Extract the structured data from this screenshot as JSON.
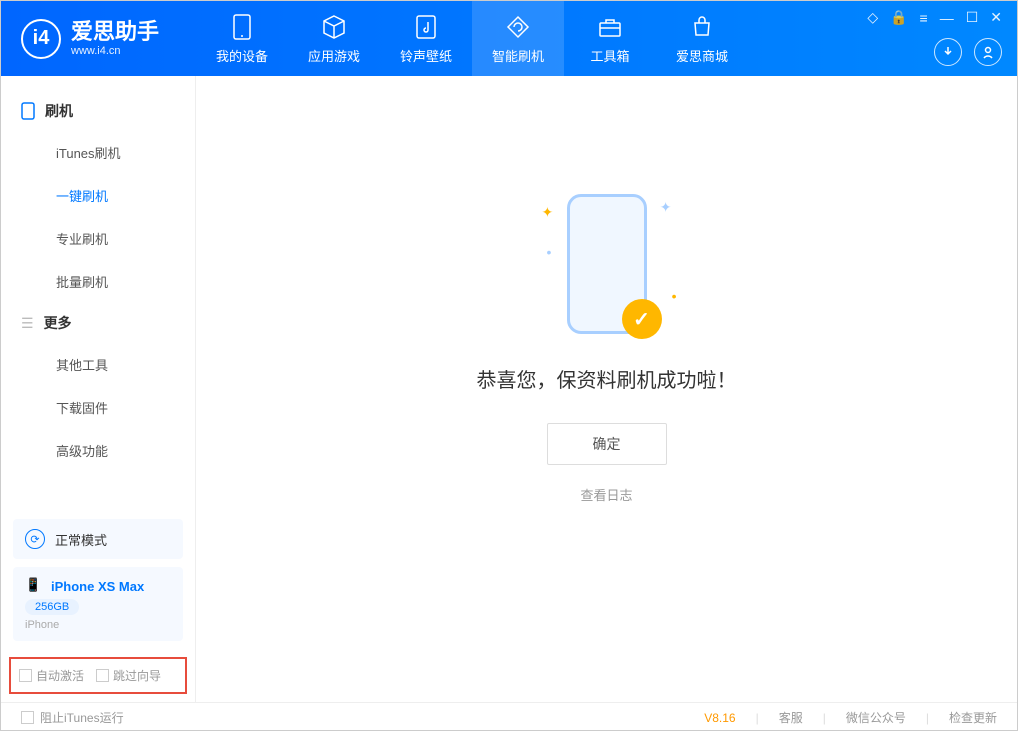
{
  "app": {
    "name": "爱思助手",
    "url": "www.i4.cn"
  },
  "nav": {
    "tabs": [
      {
        "label": "我的设备",
        "icon": "device"
      },
      {
        "label": "应用游戏",
        "icon": "cube"
      },
      {
        "label": "铃声壁纸",
        "icon": "music"
      },
      {
        "label": "智能刷机",
        "icon": "refresh"
      },
      {
        "label": "工具箱",
        "icon": "toolbox"
      },
      {
        "label": "爱思商城",
        "icon": "shop"
      }
    ]
  },
  "sidebar": {
    "section1_title": "刷机",
    "section1_items": [
      "iTunes刷机",
      "一键刷机",
      "专业刷机",
      "批量刷机"
    ],
    "section2_title": "更多",
    "section2_items": [
      "其他工具",
      "下载固件",
      "高级功能"
    ],
    "mode_label": "正常模式",
    "device": {
      "name": "iPhone XS Max",
      "capacity": "256GB",
      "type": "iPhone"
    },
    "checkbox1": "自动激活",
    "checkbox2": "跳过向导"
  },
  "main": {
    "success_message": "恭喜您，保资料刷机成功啦！",
    "ok_button": "确定",
    "view_log": "查看日志"
  },
  "footer": {
    "prevent_itunes": "阻止iTunes运行",
    "version": "V8.16",
    "links": [
      "客服",
      "微信公众号",
      "检查更新"
    ]
  }
}
